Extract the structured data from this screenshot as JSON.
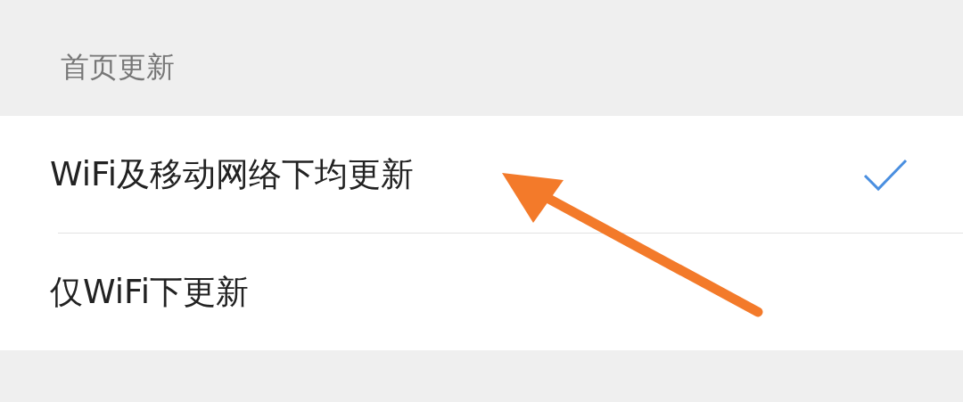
{
  "section": {
    "title": "首页更新"
  },
  "options": [
    {
      "label": "WiFi及移动网络下均更新",
      "selected": true
    },
    {
      "label": "仅WiFi下更新",
      "selected": false
    }
  ]
}
